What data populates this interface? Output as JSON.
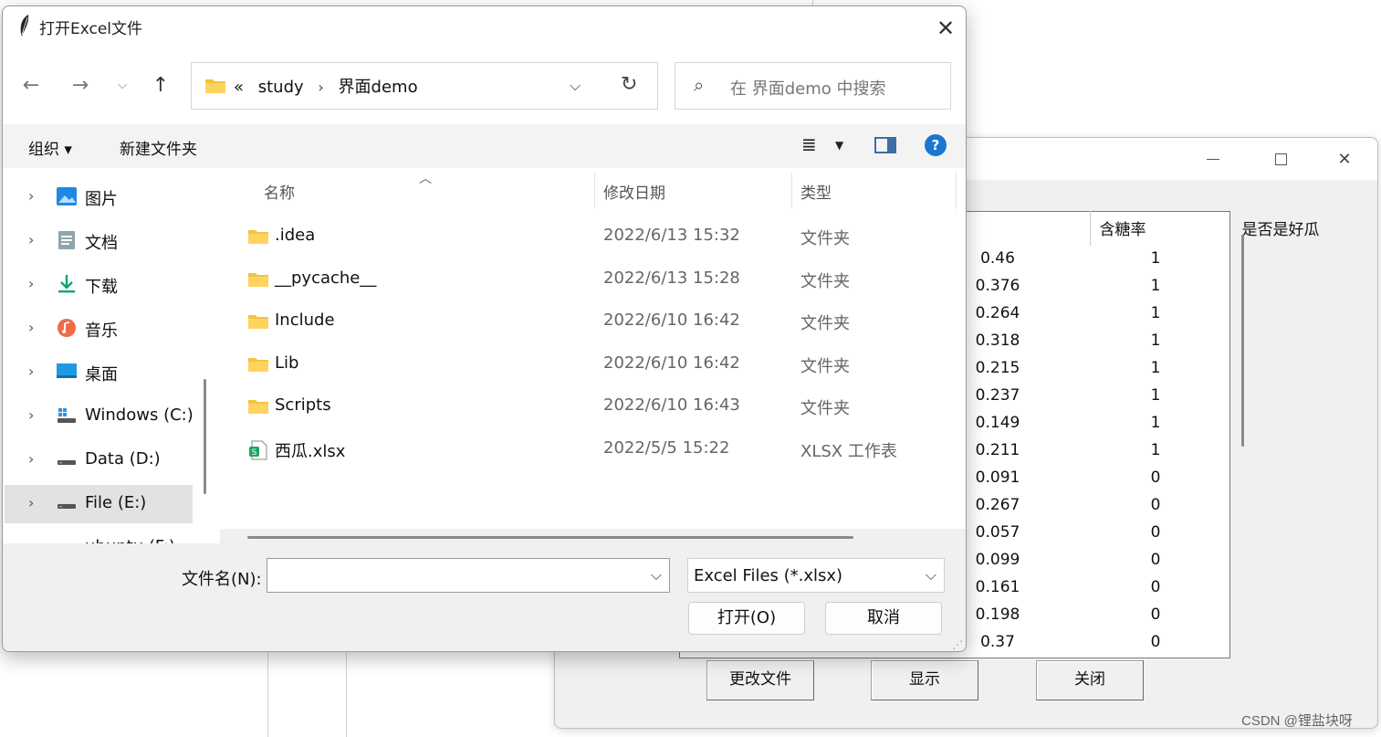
{
  "background_app": {
    "table": {
      "columns": [
        "含糖率",
        "是否是好瓜"
      ],
      "rows": [
        [
          "0.46",
          "1"
        ],
        [
          "0.376",
          "1"
        ],
        [
          "0.264",
          "1"
        ],
        [
          "0.318",
          "1"
        ],
        [
          "0.215",
          "1"
        ],
        [
          "0.237",
          "1"
        ],
        [
          "0.149",
          "1"
        ],
        [
          "0.211",
          "1"
        ],
        [
          "0.091",
          "0"
        ],
        [
          "0.267",
          "0"
        ],
        [
          "0.057",
          "0"
        ],
        [
          "0.099",
          "0"
        ],
        [
          "0.161",
          "0"
        ],
        [
          "0.198",
          "0"
        ],
        [
          "0.37",
          "0"
        ]
      ]
    },
    "buttons": {
      "change_file": "更改文件",
      "show": "显示",
      "close": "关闭"
    }
  },
  "watermark": "CSDN @锂盐块呀",
  "dialog": {
    "title": "打开Excel文件",
    "address": {
      "overflow": "«",
      "crumbs": [
        "study",
        "界面demo"
      ]
    },
    "search": {
      "placeholder": "在 界面demo 中搜索"
    },
    "commands": {
      "organize": "组织 ▾",
      "new_folder": "新建文件夹"
    },
    "nav": [
      {
        "label": "图片",
        "icon": "pictures-icon"
      },
      {
        "label": "文档",
        "icon": "documents-icon"
      },
      {
        "label": "下载",
        "icon": "downloads-icon"
      },
      {
        "label": "音乐",
        "icon": "music-icon"
      },
      {
        "label": "桌面",
        "icon": "desktop-icon"
      },
      {
        "label": "Windows (C:)",
        "icon": "windows-drive-icon"
      },
      {
        "label": "Data (D:)",
        "icon": "drive-icon"
      },
      {
        "label": "File (E:)",
        "icon": "drive-icon",
        "selected": true
      },
      {
        "label": "ubuntu (F:)",
        "icon": "drive-icon"
      }
    ],
    "columns": {
      "name": "名称",
      "date": "修改日期",
      "type": "类型"
    },
    "files": [
      {
        "name": ".idea",
        "date": "2022/6/13 15:32",
        "type": "文件夹",
        "icon": "folder-icon"
      },
      {
        "name": "__pycache__",
        "date": "2022/6/13 15:28",
        "type": "文件夹",
        "icon": "folder-icon"
      },
      {
        "name": "Include",
        "date": "2022/6/10 16:42",
        "type": "文件夹",
        "icon": "folder-icon"
      },
      {
        "name": "Lib",
        "date": "2022/6/10 16:42",
        "type": "文件夹",
        "icon": "folder-icon"
      },
      {
        "name": "Scripts",
        "date": "2022/6/10 16:43",
        "type": "文件夹",
        "icon": "folder-icon"
      },
      {
        "name": "西瓜.xlsx",
        "date": "2022/5/5 15:22",
        "type": "XLSX 工作表",
        "icon": "excel-file-icon"
      }
    ],
    "filename_label": "文件名(N):",
    "filename_value": "",
    "filetype": "Excel Files (*.xlsx)",
    "open_button": "打开(O)",
    "cancel_button": "取消"
  },
  "colors": {
    "accent": "#1976d2",
    "folder": "#f5c242",
    "excel": "#21a366"
  }
}
